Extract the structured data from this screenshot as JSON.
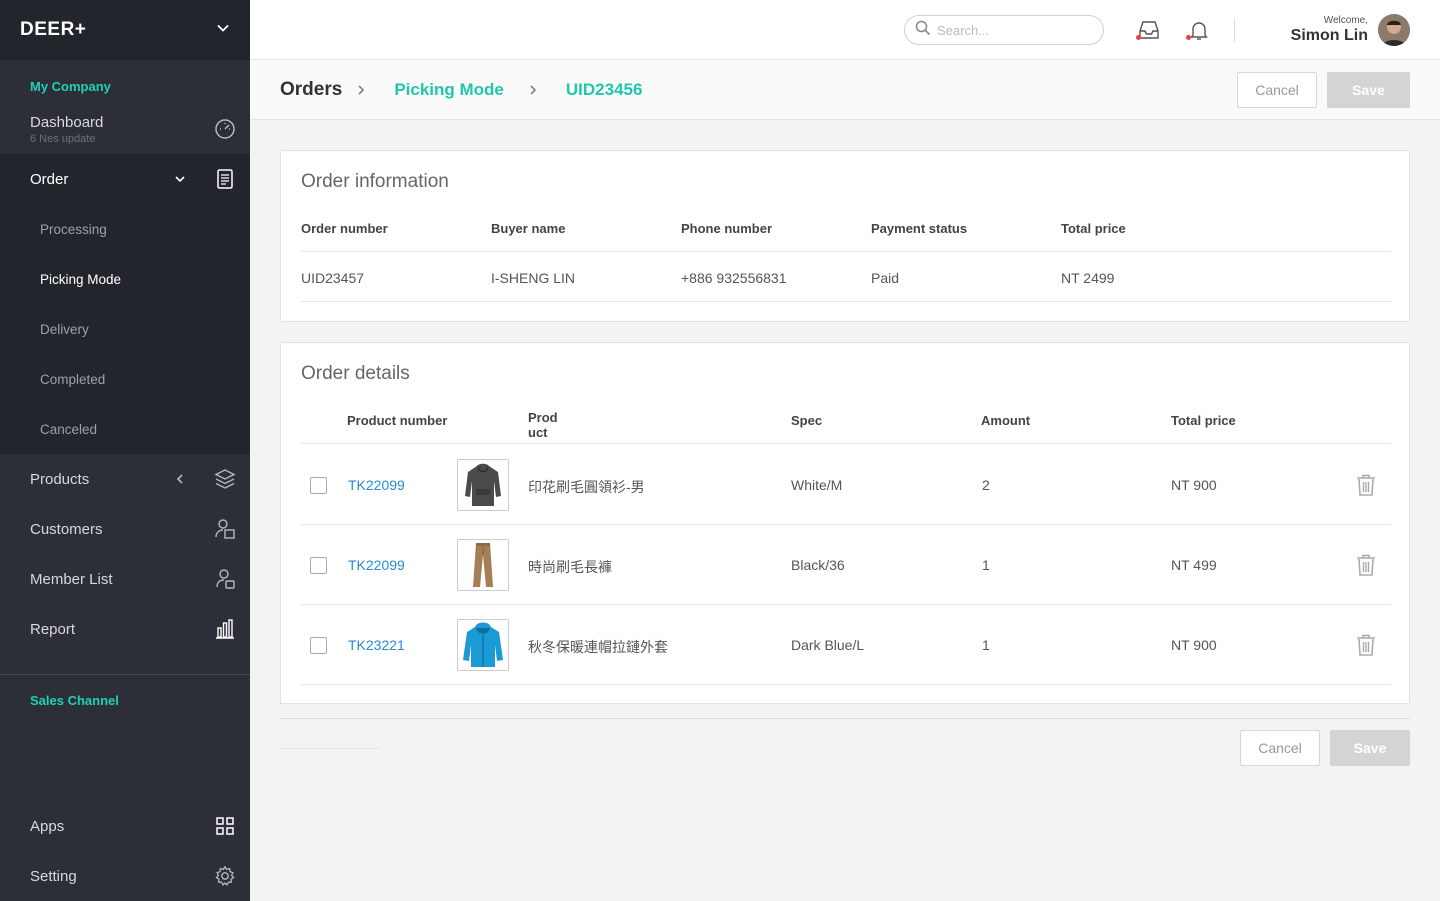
{
  "sidebar": {
    "brand": "DEER+",
    "section_company": "My Company",
    "dashboard": {
      "label": "Dashboard",
      "sub": "6 Nes update"
    },
    "order": {
      "label": "Order"
    },
    "order_sub": [
      "Processing",
      "Picking Mode",
      "Delivery",
      "Completed",
      "Canceled"
    ],
    "products": "Products",
    "customers": "Customers",
    "member_list": "Member List",
    "report": "Report",
    "section_sales": "Sales Channel",
    "apps": "Apps",
    "setting": "Setting"
  },
  "topbar": {
    "search_placeholder": "Search...",
    "welcome": "Welcome,",
    "user_name": "Simon Lin"
  },
  "header": {
    "crumb_root": "Orders",
    "crumb_mode": "Picking Mode",
    "crumb_id": "UID23456",
    "cancel": "Cancel",
    "save": "Save"
  },
  "order_info": {
    "title": "Order information",
    "headers": [
      "Order number",
      "Buyer name",
      "Phone number",
      "Payment status",
      "Total price"
    ],
    "values": [
      "UID23457",
      "I-SHENG LIN",
      "+886 932556831",
      "Paid",
      "NT 2499"
    ]
  },
  "order_details": {
    "title": "Order details",
    "headers": {
      "product_number": "Product number",
      "product": "Prod\nuct",
      "spec": "Spec",
      "amount": "Amount",
      "total": "Total price"
    },
    "rows": [
      {
        "number": "TK22099",
        "name": "印花刷毛圓領衫-男",
        "spec": "White/M",
        "amount": "2",
        "total": "NT 900",
        "image": "gray-hoodie"
      },
      {
        "number": "TK22099",
        "name": "時尚刷毛長褲",
        "spec": "Black/36",
        "amount": "1",
        "total": "NT 499",
        "image": "khaki-pants"
      },
      {
        "number": "TK23221",
        "name": "秋冬保暖連帽拉鏈外套",
        "spec": "Dark Blue/L",
        "amount": "1",
        "total": "NT 900",
        "image": "blue-jacket"
      }
    ]
  },
  "footer": {
    "cancel": "Cancel",
    "save": "Save"
  },
  "colors": {
    "accent": "#1fd1b4",
    "link": "#2a8ad4",
    "sidebar": "#2c2f38",
    "sidebar_dark": "#23252c",
    "notify_dot": "#e84040"
  }
}
